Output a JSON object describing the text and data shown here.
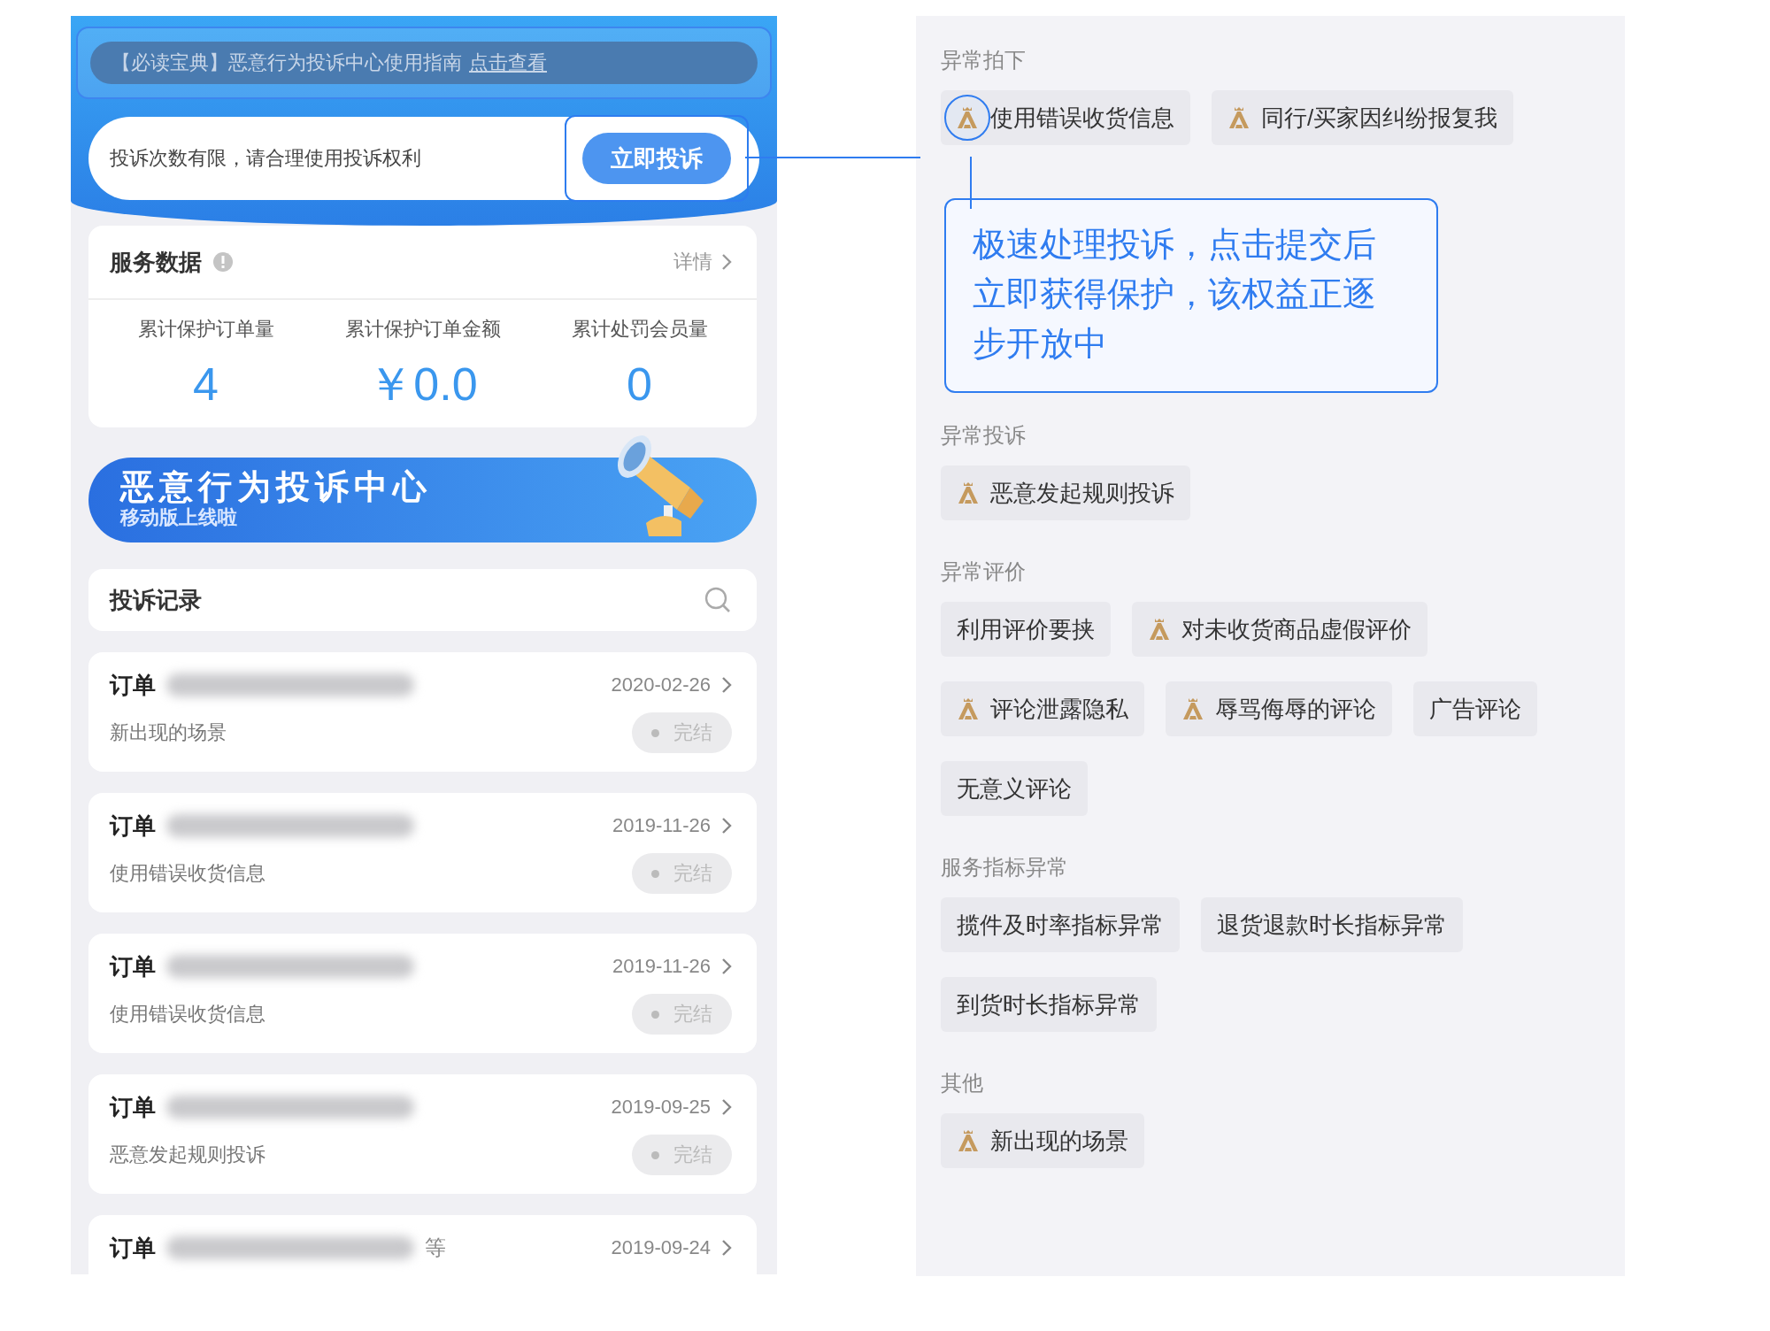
{
  "notice": {
    "text": "【必读宝典】恶意行为投诉中心使用指南",
    "link": "点击查看"
  },
  "complaint_bar": {
    "hint": "投诉次数有限，请合理使用投诉权利",
    "button": "立即投诉"
  },
  "service_data": {
    "title": "服务数据",
    "details": "详情",
    "stats": [
      {
        "label": "累计保护订单量",
        "value": "4"
      },
      {
        "label": "累计保护订单金额",
        "value": "￥0.0"
      },
      {
        "label": "累计处罚会员量",
        "value": "0"
      }
    ]
  },
  "banner": {
    "title": "恶意行为投诉中心",
    "subtitle": "移动版上线啦"
  },
  "records": {
    "title": "投诉记录",
    "orders": [
      {
        "label": "订单",
        "date": "2020-02-26",
        "scene": "新出现的场景",
        "status": "完结"
      },
      {
        "label": "订单",
        "date": "2019-11-26",
        "scene": "使用错误收货信息",
        "status": "完结"
      },
      {
        "label": "订单",
        "date": "2019-11-26",
        "scene": "使用错误收货信息",
        "status": "完结"
      },
      {
        "label": "订单",
        "date": "2019-09-25",
        "scene": "恶意发起规则投诉",
        "status": "完结"
      },
      {
        "label": "订单",
        "suffix": "等",
        "date": "2019-09-24"
      }
    ]
  },
  "callout": {
    "text": "极速处理投诉，点击提交后立即获得保护，该权益正逐步开放中"
  },
  "categories": [
    {
      "title": "异常拍下",
      "chips": [
        {
          "label": "使用错误收货信息",
          "badge": true,
          "highlighted": true
        },
        {
          "label": "同行/买家因纠纷报复我",
          "badge": true,
          "highlighted": false
        }
      ]
    },
    {
      "title": "异常投诉",
      "chips": [
        {
          "label": "恶意发起规则投诉",
          "badge": true,
          "highlighted": false
        }
      ]
    },
    {
      "title": "异常评价",
      "chips": [
        {
          "label": "利用评价要挟",
          "badge": false,
          "highlighted": false
        },
        {
          "label": "对未收货商品虚假评价",
          "badge": true,
          "highlighted": false
        },
        {
          "label": "评论泄露隐私",
          "badge": true,
          "highlighted": false
        },
        {
          "label": "辱骂侮辱的评论",
          "badge": true,
          "highlighted": false
        },
        {
          "label": "广告评论",
          "badge": false,
          "highlighted": false
        },
        {
          "label": "无意义评论",
          "badge": false,
          "highlighted": false
        }
      ]
    },
    {
      "title": "服务指标异常",
      "chips": [
        {
          "label": "揽件及时率指标异常",
          "badge": false,
          "highlighted": false
        },
        {
          "label": "退货退款时长指标异常",
          "badge": false,
          "highlighted": false
        },
        {
          "label": "到货时长指标异常",
          "badge": false,
          "highlighted": false
        }
      ]
    },
    {
      "title": "其他",
      "chips": [
        {
          "label": "新出现的场景",
          "badge": true,
          "highlighted": false
        }
      ]
    }
  ]
}
